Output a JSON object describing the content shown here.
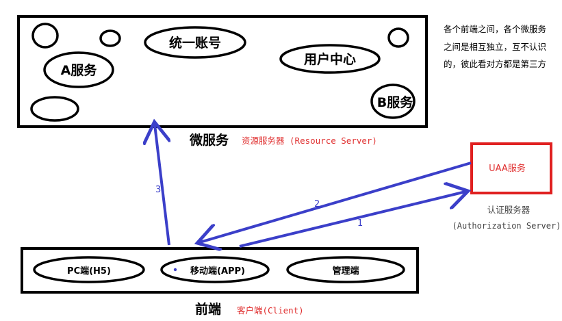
{
  "microservices": {
    "label": "微服务",
    "role": "资源服务器 (Resource Server)",
    "nodes": {
      "unified_account": "统一账号",
      "service_a": "A服务",
      "user_center": "用户中心",
      "service_b": "B服务"
    }
  },
  "uaa": {
    "label": "UAA服务",
    "role_line1": "认证服务器",
    "role_line2": "(Authorization Server)"
  },
  "frontend": {
    "label": "前端",
    "role": "客户端(Client)",
    "nodes": {
      "pc": "PC端(H5)",
      "mobile": "移动端(APP)",
      "admin": "管理端"
    }
  },
  "arrows": {
    "step1": "1",
    "step2": "2",
    "step3": "3"
  },
  "note": {
    "line1": "各个前端之间，各个微服务",
    "line2": "之间是相互独立，互不认识",
    "line3": "的，彼此看对方都是第三方"
  },
  "colors": {
    "arrow": "#3b3fc9",
    "uaa_box": "#e02020",
    "uaa_text": "#e03030",
    "role_text": "#e03030"
  }
}
